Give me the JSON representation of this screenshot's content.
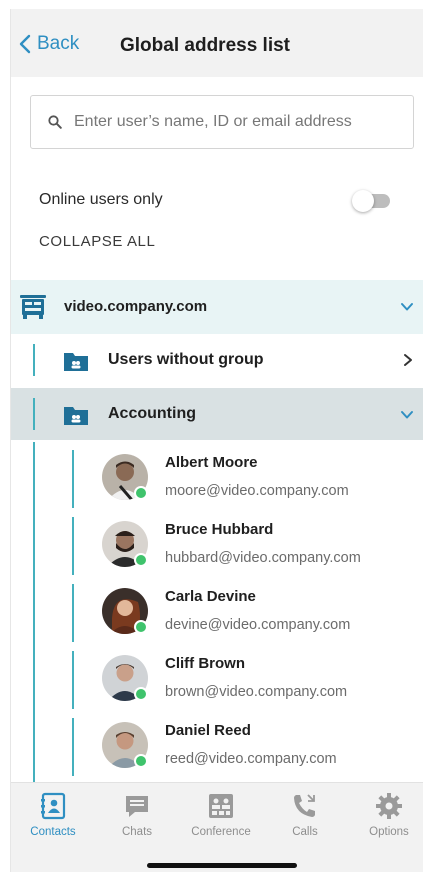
{
  "header": {
    "back_label": "Back",
    "title": "Global address list"
  },
  "search": {
    "placeholder": "Enter user’s name, ID or email address",
    "value": ""
  },
  "filters": {
    "online_label": "Online users only",
    "online_enabled": false,
    "collapse_label": "COLLAPSE ALL"
  },
  "tree": {
    "domain": "video.company.com",
    "groups": [
      {
        "label": "Users without group",
        "expanded": false
      },
      {
        "label": "Accounting",
        "expanded": true
      }
    ],
    "users": [
      {
        "name": "Albert Moore",
        "email": "moore@video.company.com",
        "status": "online"
      },
      {
        "name": "Bruce Hubbard",
        "email": "hubbard@video.company.com",
        "status": "online"
      },
      {
        "name": "Carla Devine",
        "email": "devine@video.company.com",
        "status": "online"
      },
      {
        "name": "Cliff Brown",
        "email": "brown@video.company.com",
        "status": "online"
      },
      {
        "name": "Daniel Reed",
        "email": "reed@video.company.com",
        "status": "online"
      }
    ]
  },
  "nav": {
    "items": [
      {
        "label": "Contacts",
        "icon": "contacts-icon",
        "active": true
      },
      {
        "label": "Chats",
        "icon": "chat-icon",
        "active": false
      },
      {
        "label": "Conference",
        "icon": "conference-icon",
        "active": false
      },
      {
        "label": "Calls",
        "icon": "calls-icon",
        "active": false
      },
      {
        "label": "Options",
        "icon": "gear-icon",
        "active": false
      }
    ]
  },
  "colors": {
    "accent": "#2f8fc2",
    "teal": "#44b0bd",
    "online": "#3fc36c",
    "selected_row": "#d9e1e3",
    "domain_row": "#e8f4f5"
  }
}
